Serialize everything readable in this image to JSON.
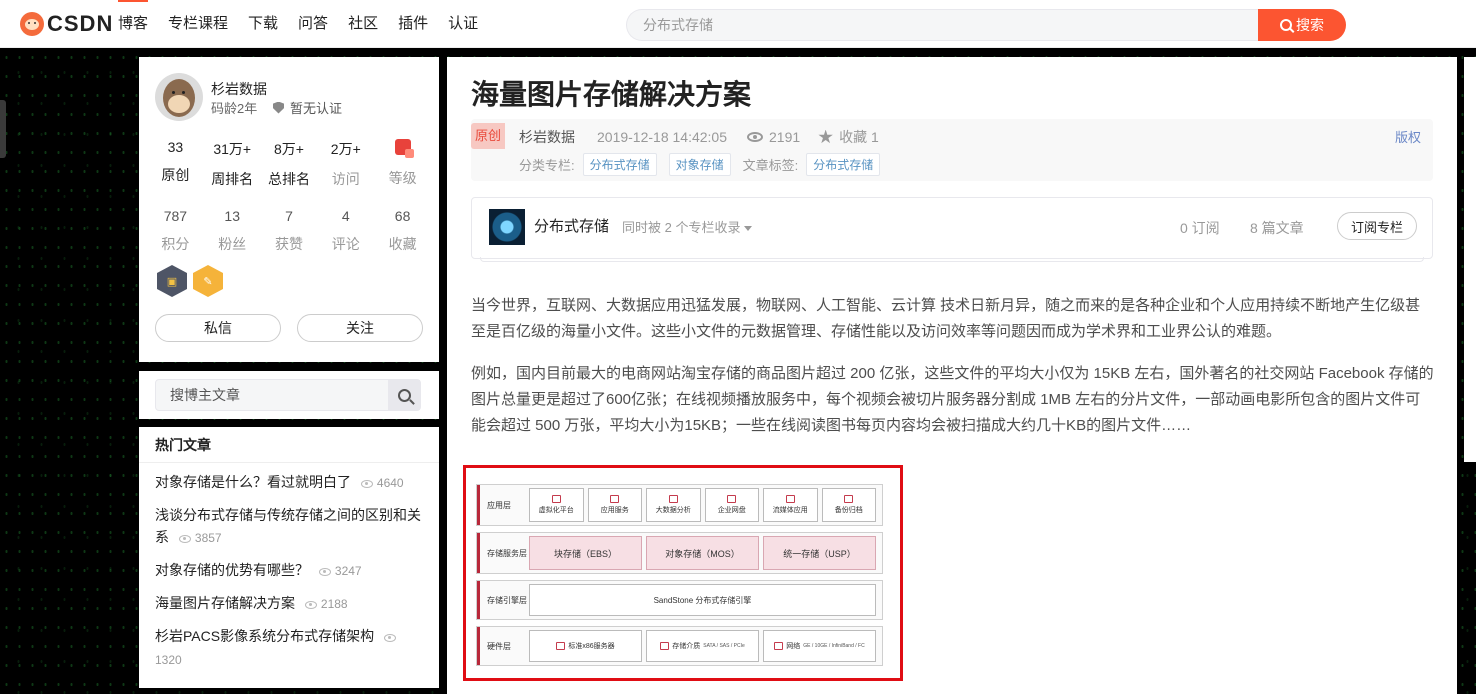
{
  "topbar": {
    "logo_text": "CSDN",
    "nav": [
      "博客",
      "专栏课程",
      "下载",
      "问答",
      "社区",
      "插件",
      "认证"
    ],
    "active_nav": 0,
    "search_placeholder": "分布式存储",
    "search_button": "搜索"
  },
  "profile": {
    "name": "杉岩数据",
    "age": "码龄2年",
    "cert": "暂无认证",
    "stats_row1": [
      {
        "value": "33",
        "label": "原创"
      },
      {
        "value": "31万+",
        "label": "周排名"
      },
      {
        "value": "8万+",
        "label": "总排名"
      },
      {
        "value": "2万+",
        "label": "访问"
      },
      {
        "value": "",
        "label": "等级"
      }
    ],
    "stats_row2": [
      {
        "value": "787",
        "label": "积分"
      },
      {
        "value": "13",
        "label": "粉丝"
      },
      {
        "value": "7",
        "label": "获赞"
      },
      {
        "value": "4",
        "label": "评论"
      },
      {
        "value": "68",
        "label": "收藏"
      }
    ],
    "message_button": "私信",
    "follow_button": "关注"
  },
  "side_search": {
    "placeholder": "搜博主文章"
  },
  "hot": {
    "title": "热门文章",
    "items": [
      {
        "title": "对象存储是什么？看过就明白了",
        "views": "4640"
      },
      {
        "title": "浅谈分布式存储与传统存储之间的区别和关系",
        "views": "3857"
      },
      {
        "title": "对象存储的优势有哪些？",
        "views": "3247"
      },
      {
        "title": "海量图片存储解决方案",
        "views": "2188"
      },
      {
        "title": "杉岩PACS影像系统分布式存储架构",
        "views": "1320"
      }
    ]
  },
  "article": {
    "title": "海量图片存储解决方案",
    "tag": "原创",
    "author": "杉岩数据",
    "time": "2019-12-18 14:42:05",
    "views": "2191",
    "favorites": "收藏 1",
    "copyright": "版权",
    "category_label": "分类专栏:",
    "category": "分布式存储",
    "category2": "对象存储",
    "tags_label": "文章标签:",
    "tag1": "分布式存储",
    "column": {
      "name": "分布式存储",
      "sub": "同时被 2 个专栏收录",
      "subscribers": "0 订阅",
      "articles": "8 篇文章",
      "subscribe_button": "订阅专栏"
    },
    "para1": "当今世界，互联网、大数据应用迅猛发展，物联网、人工智能、云计算 技术日新月异，随之而来的是各种企业和个人应用持续不断地产生亿级甚至是百亿级的海量小文件。这些小文件的元数据管理、存储性能以及访问效率等问题因而成为学术界和工业界公认的难题。",
    "para2": "例如，国内目前最大的电商网站淘宝存储的商品图片超过 200 亿张，这些文件的平均大小仅为 15KB 左右，国外著名的社交网站 Facebook 存储的图片总量更是超过了600亿张；在线视频播放服务中，每个视频会被切片服务器分割成 1MB 左右的分片文件，一部动画电影所包含的图片文件可能会超过 500 万张，平均大小为15KB；一些在线阅读图书每页内容均会被扫描成大约几十KB的图片文件……"
  },
  "diagram": {
    "layers": [
      {
        "name": "应用层",
        "cells": [
          "虚拟化平台",
          "应用服务",
          "大数据分析",
          "企业网盘",
          "流媒体应用",
          "备份归档"
        ]
      },
      {
        "name": "存储服务层",
        "cells": [
          "块存储（EBS）",
          "对象存储（MOS）",
          "统一存储（USP）"
        ]
      },
      {
        "name": "存储引擎层",
        "cells": [
          "SandStone 分布式存储引擎"
        ]
      },
      {
        "name": "硬件层",
        "cells": [
          "标准x86服务器",
          "存储介质",
          "网络"
        ],
        "subs": [
          "",
          "SATA / SAS / PCIe",
          "GE / 10GE / InfiniBand / FC"
        ]
      }
    ]
  }
}
